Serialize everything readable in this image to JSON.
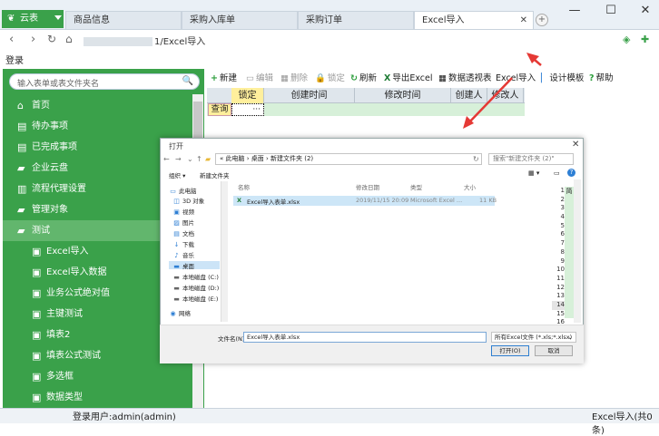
{
  "app": {
    "name": "云表",
    "logo_icon": "leaf-icon"
  },
  "tabs": [
    {
      "label": "商品信息"
    },
    {
      "label": "采购入库单"
    },
    {
      "label": "采购订单"
    },
    {
      "label": "Excel导入",
      "active": true
    }
  ],
  "window_controls": {
    "minimize": "—",
    "maximize": "☐",
    "close": "✕"
  },
  "address": {
    "url_suffix": "1/Excel导入"
  },
  "login_label": "登录",
  "sidebar": {
    "search_placeholder": "输入表单或表文件夹名",
    "items": [
      {
        "label": "首页",
        "icon": "home-icon"
      },
      {
        "label": "待办事项",
        "icon": "list-icon"
      },
      {
        "label": "已完成事项",
        "icon": "list-icon"
      },
      {
        "label": "企业云盘",
        "icon": "folder-icon"
      },
      {
        "label": "流程代理设置",
        "icon": "doc-icon"
      },
      {
        "label": "管理对象",
        "icon": "folder-icon"
      },
      {
        "label": "测试",
        "icon": "folder-icon",
        "selected": true
      },
      {
        "label": "Excel导入",
        "icon": "form-icon"
      },
      {
        "label": "Excel导入数据",
        "icon": "form-icon"
      },
      {
        "label": "业务公式绝对值",
        "icon": "form-icon"
      },
      {
        "label": "主键测试",
        "icon": "form-icon"
      },
      {
        "label": "填表2",
        "icon": "form-icon"
      },
      {
        "label": "填表公式测试",
        "icon": "form-icon"
      },
      {
        "label": "多选框",
        "icon": "form-icon"
      },
      {
        "label": "数据类型",
        "icon": "form-icon"
      }
    ]
  },
  "toolbar": {
    "new": "新建",
    "edit": "编辑",
    "delete": "删除",
    "lock": "锁定",
    "refresh": "刷新",
    "export_excel": "导出Excel",
    "pivot": "数据透视表",
    "excel_import": "Excel导入",
    "design_template": "设计模板",
    "help": "帮助"
  },
  "grid": {
    "columns": [
      "锁定",
      "创建时间",
      "修改时间",
      "创建人",
      "修改人"
    ],
    "query_label": "查询",
    "ellipsis": "···"
  },
  "dialog": {
    "title": "打开",
    "breadcrumb": "« 此电脑 › 桌面 › 新建文件夹 (2)",
    "search_placeholder": "搜索\"新建文件夹 (2)\"",
    "organize": "组织 ▾",
    "new_folder": "新建文件夹",
    "tree": [
      {
        "label": "此电脑",
        "icon": "computer-icon"
      },
      {
        "label": "3D 对象",
        "icon": "cube-icon"
      },
      {
        "label": "视频",
        "icon": "video-icon"
      },
      {
        "label": "图片",
        "icon": "picture-icon"
      },
      {
        "label": "文档",
        "icon": "document-icon"
      },
      {
        "label": "下载",
        "icon": "download-icon"
      },
      {
        "label": "音乐",
        "icon": "music-icon"
      },
      {
        "label": "桌面",
        "icon": "desktop-icon",
        "selected": true
      },
      {
        "label": "本地磁盘 (C:)",
        "icon": "drive-icon"
      },
      {
        "label": "本地磁盘 (D:)",
        "icon": "drive-icon"
      },
      {
        "label": "本地磁盘 (E:)",
        "icon": "drive-icon"
      },
      {
        "label": "网络",
        "icon": "network-icon"
      }
    ],
    "file_headers": [
      "名称",
      "修改日期",
      "类型",
      "大小"
    ],
    "files": [
      {
        "name": "Excel导入表单.xlsx",
        "modified": "2019/11/15 20:09",
        "type": "Microsoft Excel ...",
        "size": "11 KB"
      }
    ],
    "row_numbers": [
      "1",
      "2",
      "3",
      "4",
      "5",
      "6",
      "7",
      "8",
      "9",
      "10",
      "11",
      "12",
      "13",
      "14",
      "15",
      "16"
    ],
    "highlight_row": "14",
    "side_label": "简",
    "filename_label": "文件名(N):",
    "filename_value": "Excel导入表单.xlsx",
    "filetype": "所有Excel文件 (*.xls;*.xlsx)",
    "open_button": "打开(O)",
    "cancel_button": "取消"
  },
  "status": {
    "user": "登录用户:admin(admin)",
    "right": "Excel导入(共0条)"
  },
  "colors": {
    "brand_green": "#3aa14a",
    "selected_green": "#62b66d",
    "arrow_red": "#e53935"
  }
}
